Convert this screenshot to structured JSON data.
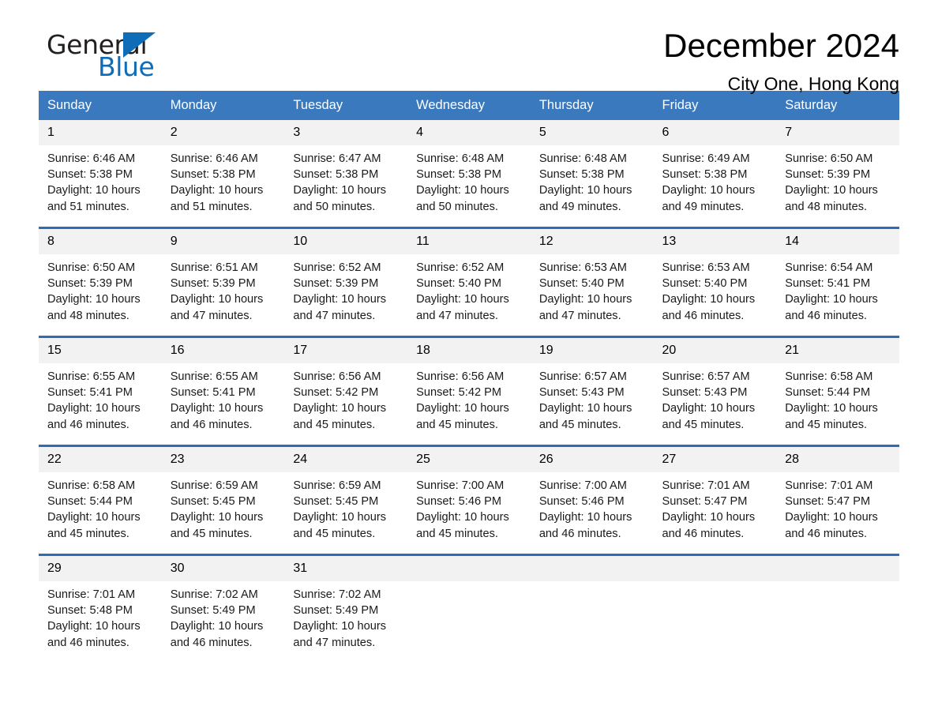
{
  "brand": {
    "name_part1": "General",
    "name_part2": "Blue",
    "triangle_color": "#0f6cb6"
  },
  "header": {
    "title": "December 2024",
    "subtitle": "City One, Hong Kong"
  },
  "theme": {
    "header_blue": "#3a79bd",
    "row_divider_blue": "#2e6cb5",
    "daynum_gray": "#f2f2f2"
  },
  "calendar": {
    "weekday_headers": [
      "Sunday",
      "Monday",
      "Tuesday",
      "Wednesday",
      "Thursday",
      "Friday",
      "Saturday"
    ],
    "weeks": [
      [
        {
          "day": "1",
          "sunrise": "Sunrise: 6:46 AM",
          "sunset": "Sunset: 5:38 PM",
          "daylight_line1": "Daylight: 10 hours",
          "daylight_line2": "and 51 minutes."
        },
        {
          "day": "2",
          "sunrise": "Sunrise: 6:46 AM",
          "sunset": "Sunset: 5:38 PM",
          "daylight_line1": "Daylight: 10 hours",
          "daylight_line2": "and 51 minutes."
        },
        {
          "day": "3",
          "sunrise": "Sunrise: 6:47 AM",
          "sunset": "Sunset: 5:38 PM",
          "daylight_line1": "Daylight: 10 hours",
          "daylight_line2": "and 50 minutes."
        },
        {
          "day": "4",
          "sunrise": "Sunrise: 6:48 AM",
          "sunset": "Sunset: 5:38 PM",
          "daylight_line1": "Daylight: 10 hours",
          "daylight_line2": "and 50 minutes."
        },
        {
          "day": "5",
          "sunrise": "Sunrise: 6:48 AM",
          "sunset": "Sunset: 5:38 PM",
          "daylight_line1": "Daylight: 10 hours",
          "daylight_line2": "and 49 minutes."
        },
        {
          "day": "6",
          "sunrise": "Sunrise: 6:49 AM",
          "sunset": "Sunset: 5:38 PM",
          "daylight_line1": "Daylight: 10 hours",
          "daylight_line2": "and 49 minutes."
        },
        {
          "day": "7",
          "sunrise": "Sunrise: 6:50 AM",
          "sunset": "Sunset: 5:39 PM",
          "daylight_line1": "Daylight: 10 hours",
          "daylight_line2": "and 48 minutes."
        }
      ],
      [
        {
          "day": "8",
          "sunrise": "Sunrise: 6:50 AM",
          "sunset": "Sunset: 5:39 PM",
          "daylight_line1": "Daylight: 10 hours",
          "daylight_line2": "and 48 minutes."
        },
        {
          "day": "9",
          "sunrise": "Sunrise: 6:51 AM",
          "sunset": "Sunset: 5:39 PM",
          "daylight_line1": "Daylight: 10 hours",
          "daylight_line2": "and 47 minutes."
        },
        {
          "day": "10",
          "sunrise": "Sunrise: 6:52 AM",
          "sunset": "Sunset: 5:39 PM",
          "daylight_line1": "Daylight: 10 hours",
          "daylight_line2": "and 47 minutes."
        },
        {
          "day": "11",
          "sunrise": "Sunrise: 6:52 AM",
          "sunset": "Sunset: 5:40 PM",
          "daylight_line1": "Daylight: 10 hours",
          "daylight_line2": "and 47 minutes."
        },
        {
          "day": "12",
          "sunrise": "Sunrise: 6:53 AM",
          "sunset": "Sunset: 5:40 PM",
          "daylight_line1": "Daylight: 10 hours",
          "daylight_line2": "and 47 minutes."
        },
        {
          "day": "13",
          "sunrise": "Sunrise: 6:53 AM",
          "sunset": "Sunset: 5:40 PM",
          "daylight_line1": "Daylight: 10 hours",
          "daylight_line2": "and 46 minutes."
        },
        {
          "day": "14",
          "sunrise": "Sunrise: 6:54 AM",
          "sunset": "Sunset: 5:41 PM",
          "daylight_line1": "Daylight: 10 hours",
          "daylight_line2": "and 46 minutes."
        }
      ],
      [
        {
          "day": "15",
          "sunrise": "Sunrise: 6:55 AM",
          "sunset": "Sunset: 5:41 PM",
          "daylight_line1": "Daylight: 10 hours",
          "daylight_line2": "and 46 minutes."
        },
        {
          "day": "16",
          "sunrise": "Sunrise: 6:55 AM",
          "sunset": "Sunset: 5:41 PM",
          "daylight_line1": "Daylight: 10 hours",
          "daylight_line2": "and 46 minutes."
        },
        {
          "day": "17",
          "sunrise": "Sunrise: 6:56 AM",
          "sunset": "Sunset: 5:42 PM",
          "daylight_line1": "Daylight: 10 hours",
          "daylight_line2": "and 45 minutes."
        },
        {
          "day": "18",
          "sunrise": "Sunrise: 6:56 AM",
          "sunset": "Sunset: 5:42 PM",
          "daylight_line1": "Daylight: 10 hours",
          "daylight_line2": "and 45 minutes."
        },
        {
          "day": "19",
          "sunrise": "Sunrise: 6:57 AM",
          "sunset": "Sunset: 5:43 PM",
          "daylight_line1": "Daylight: 10 hours",
          "daylight_line2": "and 45 minutes."
        },
        {
          "day": "20",
          "sunrise": "Sunrise: 6:57 AM",
          "sunset": "Sunset: 5:43 PM",
          "daylight_line1": "Daylight: 10 hours",
          "daylight_line2": "and 45 minutes."
        },
        {
          "day": "21",
          "sunrise": "Sunrise: 6:58 AM",
          "sunset": "Sunset: 5:44 PM",
          "daylight_line1": "Daylight: 10 hours",
          "daylight_line2": "and 45 minutes."
        }
      ],
      [
        {
          "day": "22",
          "sunrise": "Sunrise: 6:58 AM",
          "sunset": "Sunset: 5:44 PM",
          "daylight_line1": "Daylight: 10 hours",
          "daylight_line2": "and 45 minutes."
        },
        {
          "day": "23",
          "sunrise": "Sunrise: 6:59 AM",
          "sunset": "Sunset: 5:45 PM",
          "daylight_line1": "Daylight: 10 hours",
          "daylight_line2": "and 45 minutes."
        },
        {
          "day": "24",
          "sunrise": "Sunrise: 6:59 AM",
          "sunset": "Sunset: 5:45 PM",
          "daylight_line1": "Daylight: 10 hours",
          "daylight_line2": "and 45 minutes."
        },
        {
          "day": "25",
          "sunrise": "Sunrise: 7:00 AM",
          "sunset": "Sunset: 5:46 PM",
          "daylight_line1": "Daylight: 10 hours",
          "daylight_line2": "and 45 minutes."
        },
        {
          "day": "26",
          "sunrise": "Sunrise: 7:00 AM",
          "sunset": "Sunset: 5:46 PM",
          "daylight_line1": "Daylight: 10 hours",
          "daylight_line2": "and 46 minutes."
        },
        {
          "day": "27",
          "sunrise": "Sunrise: 7:01 AM",
          "sunset": "Sunset: 5:47 PM",
          "daylight_line1": "Daylight: 10 hours",
          "daylight_line2": "and 46 minutes."
        },
        {
          "day": "28",
          "sunrise": "Sunrise: 7:01 AM",
          "sunset": "Sunset: 5:47 PM",
          "daylight_line1": "Daylight: 10 hours",
          "daylight_line2": "and 46 minutes."
        }
      ],
      [
        {
          "day": "29",
          "sunrise": "Sunrise: 7:01 AM",
          "sunset": "Sunset: 5:48 PM",
          "daylight_line1": "Daylight: 10 hours",
          "daylight_line2": "and 46 minutes."
        },
        {
          "day": "30",
          "sunrise": "Sunrise: 7:02 AM",
          "sunset": "Sunset: 5:49 PM",
          "daylight_line1": "Daylight: 10 hours",
          "daylight_line2": "and 46 minutes."
        },
        {
          "day": "31",
          "sunrise": "Sunrise: 7:02 AM",
          "sunset": "Sunset: 5:49 PM",
          "daylight_line1": "Daylight: 10 hours",
          "daylight_line2": "and 47 minutes."
        },
        {
          "day": "",
          "sunrise": "",
          "sunset": "",
          "daylight_line1": "",
          "daylight_line2": ""
        },
        {
          "day": "",
          "sunrise": "",
          "sunset": "",
          "daylight_line1": "",
          "daylight_line2": ""
        },
        {
          "day": "",
          "sunrise": "",
          "sunset": "",
          "daylight_line1": "",
          "daylight_line2": ""
        },
        {
          "day": "",
          "sunrise": "",
          "sunset": "",
          "daylight_line1": "",
          "daylight_line2": ""
        }
      ]
    ]
  }
}
